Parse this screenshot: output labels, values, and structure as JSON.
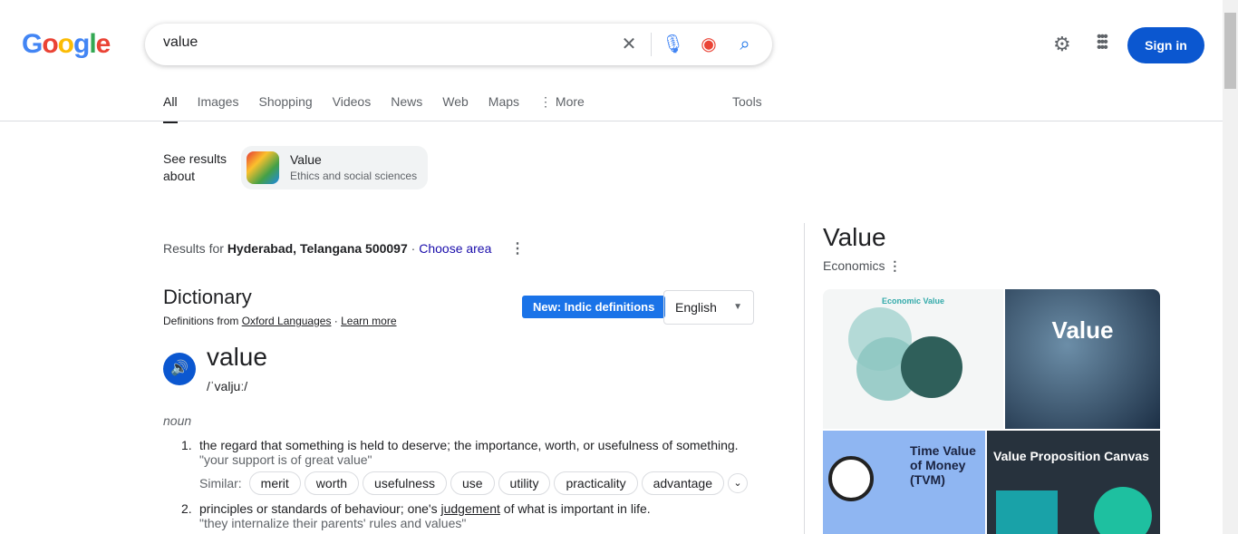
{
  "logo": "Google",
  "search": {
    "query": "value"
  },
  "header": {
    "signin": "Sign in"
  },
  "tabs": [
    {
      "label": "All"
    },
    {
      "label": "Images"
    },
    {
      "label": "Shopping"
    },
    {
      "label": "Videos"
    },
    {
      "label": "News"
    },
    {
      "label": "Web"
    },
    {
      "label": "Maps"
    },
    {
      "label": "⋮ More"
    }
  ],
  "tools": "Tools",
  "see_results": {
    "label": "See results about",
    "title": "Value",
    "subtitle": "Ethics and social sciences"
  },
  "location": {
    "prefix": "Results for ",
    "place": "Hyderabad, Telangana 500097",
    "sep": " · ",
    "choose": "Choose area"
  },
  "dictionary": {
    "title": "Dictionary",
    "from": "Definitions from ",
    "source": "Oxford Languages",
    "sep": " · ",
    "learn": "Learn more",
    "badge": "New: Indic definitions",
    "language": "English",
    "word": "value",
    "phonetic": "/ˈvaljuː/",
    "pos": "noun",
    "definitions": [
      {
        "num": "1.",
        "text": "the regard that something is held to deserve; the importance, worth, or usefulness of something.",
        "example": "\"your support is of great value\""
      },
      {
        "num": "2.",
        "pre": "principles or standards of behaviour; one's ",
        "link": "judgement",
        "post": " of what is important in life.",
        "example": "\"they internalize their parents' rules and values\""
      }
    ],
    "similar_label": "Similar:",
    "similar": [
      "merit",
      "worth",
      "usefulness",
      "use",
      "utility",
      "practicality",
      "advantage"
    ]
  },
  "knowledge_panel": {
    "title": "Value",
    "subtitle": "Economics",
    "images": [
      "Economic Value",
      "Value",
      "Time Value of Money (TVM)",
      "Value Proposition Canvas"
    ]
  }
}
